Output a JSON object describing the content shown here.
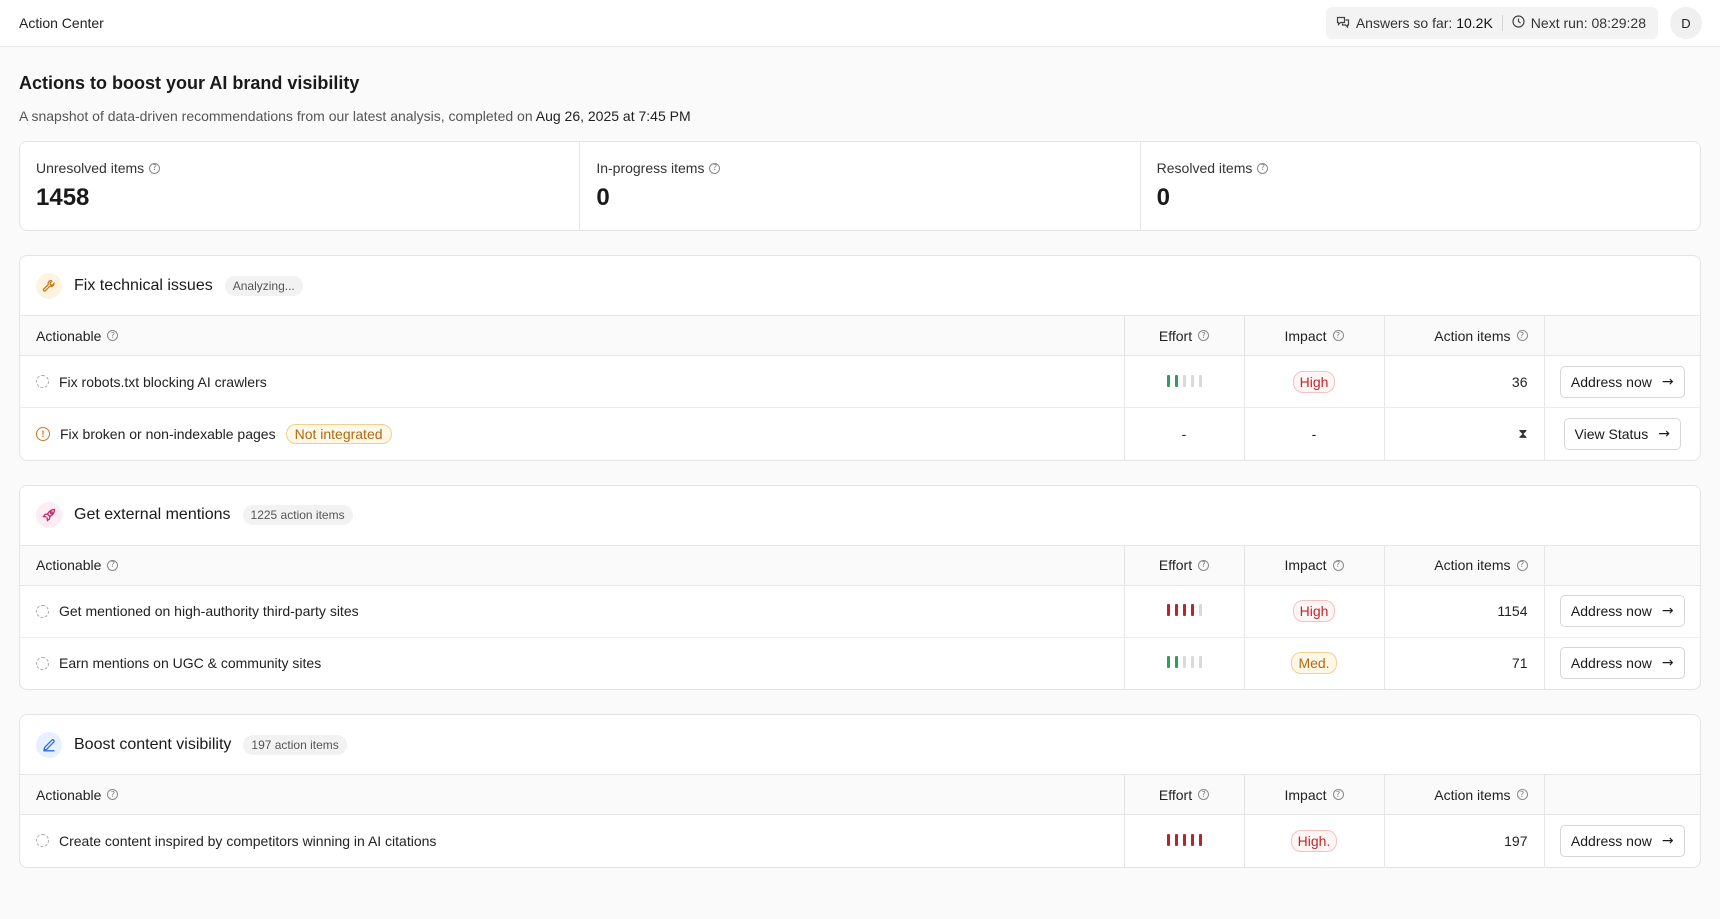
{
  "header": {
    "title": "Action Center",
    "answers_label": "Answers so far:",
    "answers_value": "10.2K",
    "next_run_label": "Next run:",
    "next_run_value": "08:29:28",
    "avatar_initial": "D"
  },
  "page": {
    "title": "Actions to boost your AI brand visibility",
    "subtitle_prefix": "A snapshot of data-driven recommendations from our latest analysis, completed on",
    "subtitle_date": "Aug 26, 2025 at 7:45 PM"
  },
  "stats": [
    {
      "label": "Unresolved items",
      "value": "1458"
    },
    {
      "label": "In-progress items",
      "value": "0"
    },
    {
      "label": "Resolved items",
      "value": "0"
    }
  ],
  "columns": {
    "actionable": "Actionable",
    "effort": "Effort",
    "impact": "Impact",
    "action_items": "Action items"
  },
  "sections": [
    {
      "title": "Fix technical issues",
      "badge": "Analyzing...",
      "icon": "wrench-icon",
      "icon_color": "#c7791a",
      "icon_bg": "#fdf3e1",
      "rows": [
        {
          "label": "Fix robots.txt blocking AI crawlers",
          "effort": 2,
          "effort_color": "green",
          "impact": "High",
          "impact_level": "high",
          "count": "36",
          "button": "Address now"
        },
        {
          "label": "Fix broken or non-indexable pages",
          "tag": "Not integrated",
          "effort_text": "-",
          "impact_text": "-",
          "button": "View Status"
        }
      ]
    },
    {
      "title": "Get external mentions",
      "badge": "1225 action items",
      "icon": "rocket-icon",
      "icon_color": "#c2286b",
      "icon_bg": "#fdecf3",
      "rows": [
        {
          "label": "Get mentioned on high-authority third-party sites",
          "effort": 4,
          "effort_color": "red",
          "impact": "High",
          "impact_level": "high",
          "count": "1154",
          "button": "Address now"
        },
        {
          "label": "Earn mentions on UGC & community sites",
          "effort": 2,
          "effort_color": "green",
          "impact": "Med.",
          "impact_level": "med",
          "count": "71",
          "button": "Address now"
        }
      ]
    },
    {
      "title": "Boost content visibility",
      "badge": "197 action items",
      "icon": "pen-icon",
      "icon_color": "#2f6fd6",
      "icon_bg": "#e8f0fd",
      "rows": [
        {
          "label": "Create content inspired by competitors winning in AI citations",
          "effort": 5,
          "effort_color": "red",
          "impact": "High.",
          "impact_level": "high",
          "count": "197",
          "button": "Address now"
        }
      ]
    }
  ]
}
